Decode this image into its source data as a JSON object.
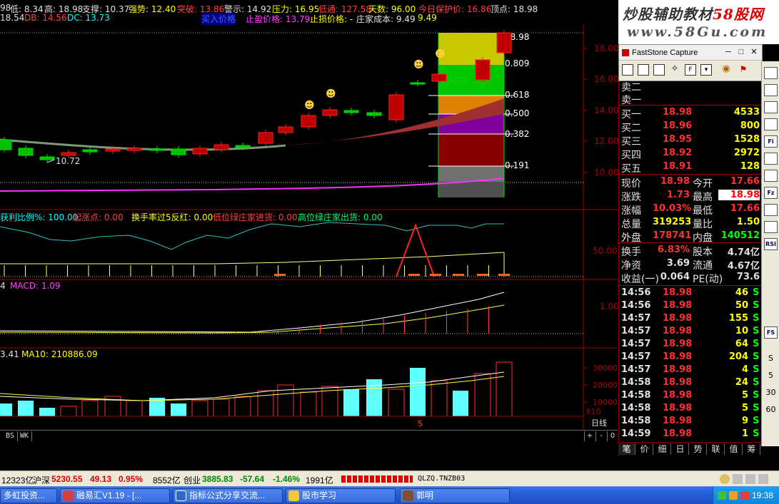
{
  "header": {
    "row1": [
      {
        "t": "98",
        "c": "wht"
      },
      {
        "t": "低: 8.34",
        "c": "wht"
      },
      {
        "t": "高: 18.98",
        "c": "wht"
      },
      {
        "t": "支撑: 10.37",
        "c": "wht"
      },
      {
        "t": "强势: 12.40",
        "c": "yel"
      },
      {
        "t": "突破: 13.86",
        "c": "red"
      },
      {
        "t": "警示: 14.92",
        "c": "wht"
      },
      {
        "t": "压力: 16.95",
        "c": "yel"
      },
      {
        "t": "低通: 127.58",
        "c": "red"
      },
      {
        "t": "天数: 96.00",
        "c": "yel"
      },
      {
        "t": "今日保护价: 16.86",
        "c": "red"
      },
      {
        "t": "顶点: 18.98",
        "c": "wht"
      }
    ],
    "row2": [
      {
        "t": "18.54",
        "c": "wht"
      },
      {
        "t": "DB: 14.56",
        "c": "red"
      },
      {
        "t": "DC: 13.73",
        "c": "cyn"
      },
      {
        "t": "买入价格",
        "c": "blu"
      },
      {
        "t": "止盈价格: 13.79",
        "c": "mag"
      },
      {
        "t": "止损价格: -",
        "c": "yel"
      },
      {
        "t": "庄家成本: 9.49",
        "c": "wht"
      },
      {
        "t": "9.49",
        "c": "yel"
      }
    ]
  },
  "price_axis": [
    "18.00",
    "16.00",
    "14.00",
    "12.00",
    "10.00"
  ],
  "fib_labels": [
    "18.98",
    "0.809",
    "0.618",
    "0.500",
    "0.382",
    "0.191"
  ],
  "low_label": "10.72",
  "panel2": {
    "labels": [
      {
        "t": "获利比例%: 100.00",
        "c": "cyn"
      },
      {
        "t": "起涨点: 0.00",
        "c": "red"
      },
      {
        "t": "换手率过5反红: 0.00",
        "c": "yel"
      },
      {
        "t": "低位绿庄家进货: 0.00",
        "c": "red"
      },
      {
        "t": "高位绿庄家出货: 0.00",
        "c": "grn"
      }
    ],
    "axis": "50.00"
  },
  "panel3": {
    "labels": [
      {
        "t": "4",
        "c": "wht"
      },
      {
        "t": "MACD: 1.09",
        "c": "mag"
      }
    ],
    "axis": "1.00"
  },
  "panel4": {
    "labels": [
      {
        "t": "3.41",
        "c": "wht"
      },
      {
        "t": "MA10: 210886.09",
        "c": "yel"
      }
    ],
    "axis": [
      "30000",
      "20000",
      "10000"
    ],
    "unit": "X10",
    "period": "日线",
    "mark": "5"
  },
  "watermark": {
    "line1a": "炒股辅助教材",
    "line1b": "58股网",
    "line2": "www.58Gu.com"
  },
  "faststone": {
    "title": "FastStone Capture",
    "min": "─",
    "restore": "□",
    "close": "✕"
  },
  "sell_labels": [
    "卖二",
    "卖一"
  ],
  "buy": [
    {
      "label": "买一",
      "price": "18.98",
      "vol": "4533"
    },
    {
      "label": "买二",
      "price": "18.96",
      "vol": "800"
    },
    {
      "label": "买三",
      "price": "18.95",
      "vol": "1528"
    },
    {
      "label": "买四",
      "price": "18.92",
      "vol": "2972"
    },
    {
      "label": "买五",
      "price": "18.91",
      "vol": "128"
    }
  ],
  "quote": [
    {
      "l1": "现价",
      "v1": "18.98",
      "l2": "今开",
      "v2": "17.66"
    },
    {
      "l1": "涨跌",
      "v1": "1.73",
      "l2": "最高",
      "v2": "18.98"
    },
    {
      "l1": "涨幅",
      "v1": "10.03%",
      "l2": "最低",
      "v2": "17.66"
    },
    {
      "l1": "总量",
      "v1": "319253",
      "l2": "量比",
      "v2": "1.50"
    },
    {
      "l1": "外盘",
      "v1": "178741",
      "l2": "内盘",
      "v2": "140512"
    }
  ],
  "quote2": [
    {
      "l1": "换手",
      "v1": "6.83%",
      "l2": "股本",
      "v2": "4.74亿"
    },
    {
      "l1": "净资",
      "v1": "3.69",
      "l2": "流通",
      "v2": "4.67亿"
    },
    {
      "l1": "收益(一)",
      "v1": "0.064",
      "l2": "PE(动)",
      "v2": "73.6"
    }
  ],
  "ticks": [
    {
      "time": "14:56",
      "price": "18.98",
      "vol": "46",
      "bs": "S"
    },
    {
      "time": "14:56",
      "price": "18.98",
      "vol": "50",
      "bs": "S"
    },
    {
      "time": "14:57",
      "price": "18.98",
      "vol": "155",
      "bs": "S"
    },
    {
      "time": "14:57",
      "price": "18.98",
      "vol": "10",
      "bs": "S"
    },
    {
      "time": "14:57",
      "price": "18.98",
      "vol": "64",
      "bs": "S"
    },
    {
      "time": "14:57",
      "price": "18.98",
      "vol": "204",
      "bs": "S"
    },
    {
      "time": "14:57",
      "price": "18.98",
      "vol": "4",
      "bs": "S"
    },
    {
      "time": "14:58",
      "price": "18.98",
      "vol": "24",
      "bs": "S"
    },
    {
      "time": "14:58",
      "price": "18.98",
      "vol": "5",
      "bs": "S"
    },
    {
      "time": "14:58",
      "price": "18.98",
      "vol": "5",
      "bs": "S"
    },
    {
      "time": "14:58",
      "price": "18.98",
      "vol": "9",
      "bs": "S"
    },
    {
      "time": "14:59",
      "price": "18.98",
      "vol": "1",
      "bs": "S"
    }
  ],
  "right_tabs": [
    "笔",
    "价",
    "细",
    "日",
    "势",
    "联",
    "值",
    "筹"
  ],
  "icon_col": [
    "Fi",
    "Fz",
    "RSI",
    "FS",
    "S",
    "5",
    "30",
    "60"
  ],
  "bs_buttons": [
    "BS",
    "WK"
  ],
  "zoom": [
    "+",
    "-",
    "0"
  ],
  "indexbar": {
    "a": "12323亿",
    "sh_label": "沪深",
    "sh_val": "5230.55",
    "sh_chg": "49.13",
    "sh_pct": "0.95%",
    "sh_amt": "8552亿",
    "cy_label": "创业",
    "cy_val": "3885.83",
    "cy_chg": "-57.64",
    "cy_pct": "-1.46%",
    "cy_amt": "1991亿",
    "code": "QLZQ.TNZB03"
  },
  "taskbar": {
    "items": [
      "多虹投资...",
      "融易汇V1.19 - [...",
      "指标公式分享交流...",
      "股市学习",
      "郭明"
    ],
    "clock": "19:38"
  }
}
